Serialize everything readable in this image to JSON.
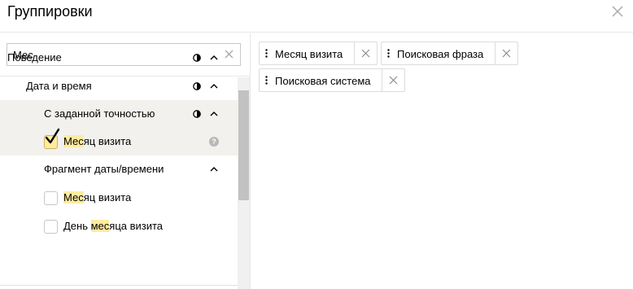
{
  "dialog": {
    "title": "Группировки"
  },
  "search": {
    "value": "Мес",
    "placeholder": ""
  },
  "tree": {
    "nodes": [
      {
        "label": "Поведение"
      },
      {
        "label": "Дата и время"
      },
      {
        "label": "С заданной точностью"
      },
      {
        "label_hl": "Мес",
        "label_rest": "яц визита",
        "checked": true
      },
      {
        "label": "Фрагмент даты/времени"
      },
      {
        "label_hl": "Мес",
        "label_rest": "яц визита",
        "checked": false
      },
      {
        "label_pre": "День ",
        "label_hl": "мес",
        "label_rest": "яца визита",
        "checked": false
      }
    ]
  },
  "selected": {
    "chips": [
      {
        "label": "Месяц визита"
      },
      {
        "label": "Поисковая фраза"
      },
      {
        "label": "Поисковая система"
      }
    ]
  },
  "icons": {
    "close": "close-icon",
    "clear": "clear-search-icon",
    "half_circle": "half-circle-icon",
    "caret": "chevron-up-icon",
    "drag": "drag-handle-icon",
    "help": "help-icon",
    "check": "checkmark-icon"
  },
  "colors": {
    "highlight": "#ffeba0",
    "row_highlight": "#f3f1ed",
    "border": "#dcdcdc",
    "scroll_thumb": "#c2c2c2"
  }
}
